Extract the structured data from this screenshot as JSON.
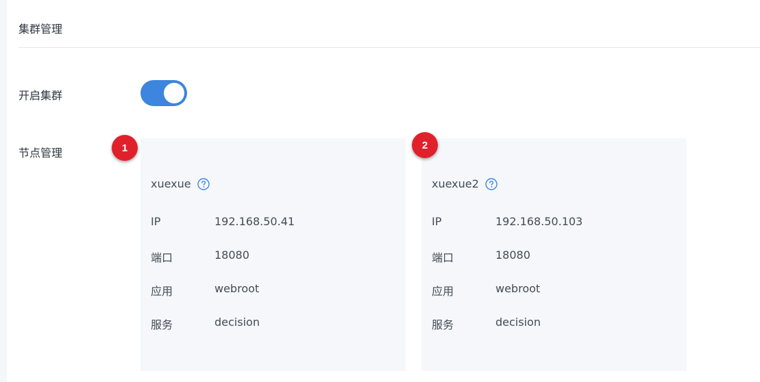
{
  "header": {
    "title": "集群管理"
  },
  "cluster": {
    "enable_label": "开启集群",
    "enabled": true,
    "nodes_label": "节点管理"
  },
  "nodes": [
    {
      "badge": "1",
      "name": "xuexue",
      "fields": [
        {
          "label": "IP",
          "value": "192.168.50.41"
        },
        {
          "label": "端口",
          "value": "18080"
        },
        {
          "label": "应用",
          "value": "webroot"
        },
        {
          "label": "服务",
          "value": "decision"
        }
      ]
    },
    {
      "badge": "2",
      "name": "xuexue2",
      "fields": [
        {
          "label": "IP",
          "value": "192.168.50.103"
        },
        {
          "label": "端口",
          "value": "18080"
        },
        {
          "label": "应用",
          "value": "webroot"
        },
        {
          "label": "服务",
          "value": "decision"
        }
      ]
    }
  ],
  "colors": {
    "toggle_on": "#3d85de",
    "card_background": "#f5f7fa",
    "badge": "#e0212c",
    "help_icon": "#3d85de"
  },
  "icons": {
    "help": "question-circle-icon"
  }
}
